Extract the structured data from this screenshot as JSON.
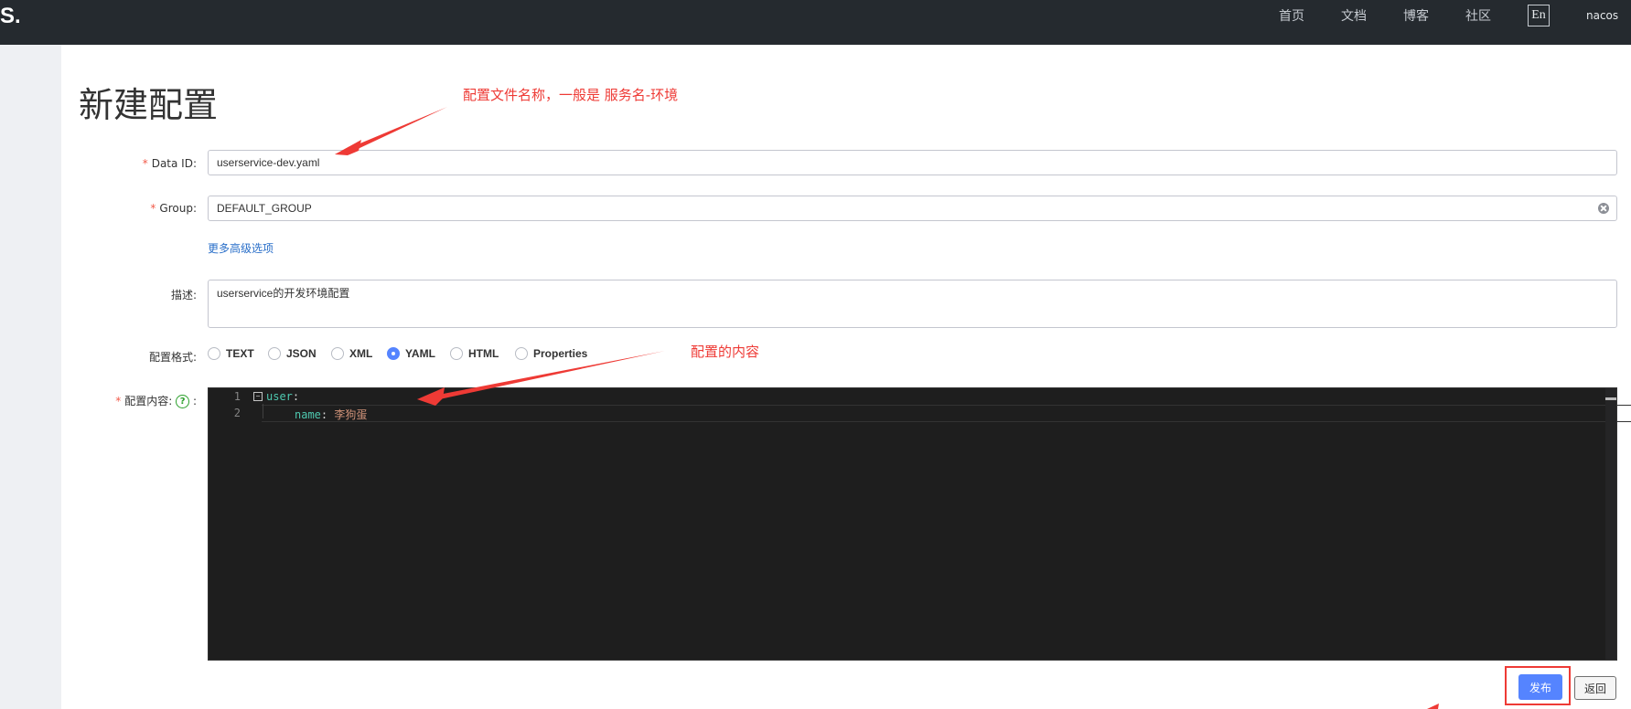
{
  "header": {
    "logo_text": "S.",
    "nav": [
      "首页",
      "文档",
      "博客",
      "社区"
    ],
    "lang": "En",
    "user": "nacos"
  },
  "page": {
    "title": "新建配置"
  },
  "annotations": {
    "data_id_note": "配置文件名称，一般是 服务名-环境",
    "content_note": "配置的内容"
  },
  "form": {
    "data_id": {
      "label": "Data ID:",
      "value": "userservice-dev.yaml"
    },
    "group": {
      "label": "Group:",
      "value": "DEFAULT_GROUP"
    },
    "advanced_link": "更多高级选项",
    "description": {
      "label": "描述:",
      "value": "userservice的开发环境配置"
    },
    "format": {
      "label": "配置格式:",
      "options": [
        "TEXT",
        "JSON",
        "XML",
        "YAML",
        "HTML",
        "Properties"
      ],
      "selected": "YAML"
    },
    "content": {
      "label": "配置内容:",
      "colon": ":",
      "help_icon": "?",
      "lines": [
        {
          "num": "1",
          "key": "user",
          "sep": ":",
          "value": ""
        },
        {
          "num": "2",
          "key": "name",
          "sep": ": ",
          "value": "李狗蛋"
        }
      ]
    }
  },
  "actions": {
    "publish": "发布",
    "back": "返回"
  },
  "colors": {
    "header_bg": "#252a2f",
    "primary": "#5584ff",
    "annotation": "#ee3a35",
    "editor_bg": "#1e1e1e"
  }
}
